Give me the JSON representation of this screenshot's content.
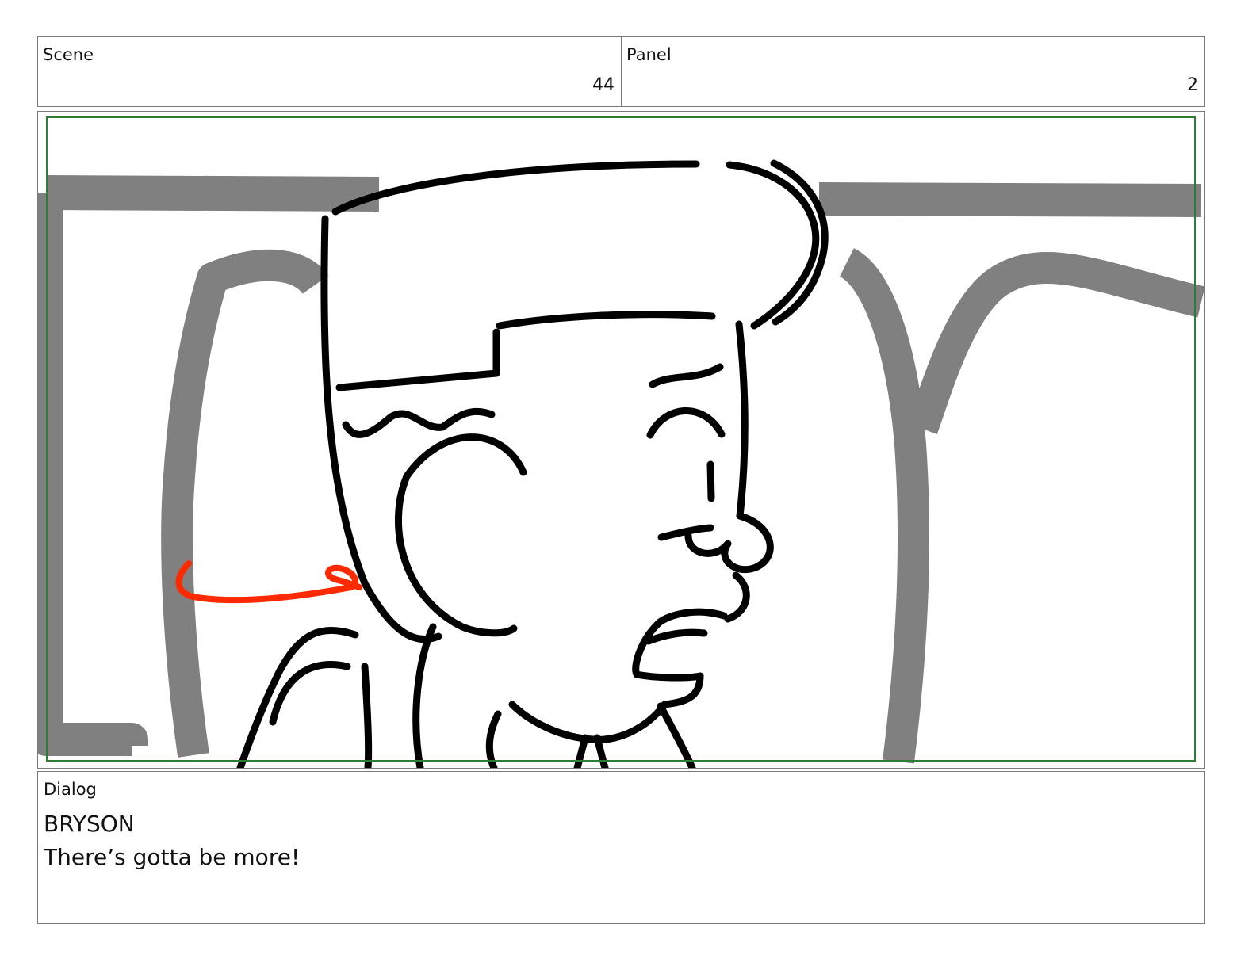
{
  "header": {
    "scene_label": "Scene",
    "scene_value": "44",
    "panel_label": "Panel",
    "panel_value": "2"
  },
  "frame": {
    "safe_area_color": "#2e7d32",
    "background_line_color": "#808080",
    "annotation_color": "#ff2a00"
  },
  "dialog": {
    "label": "Dialog",
    "speaker": "BRYSON",
    "line": "There’s gotta be more!"
  }
}
